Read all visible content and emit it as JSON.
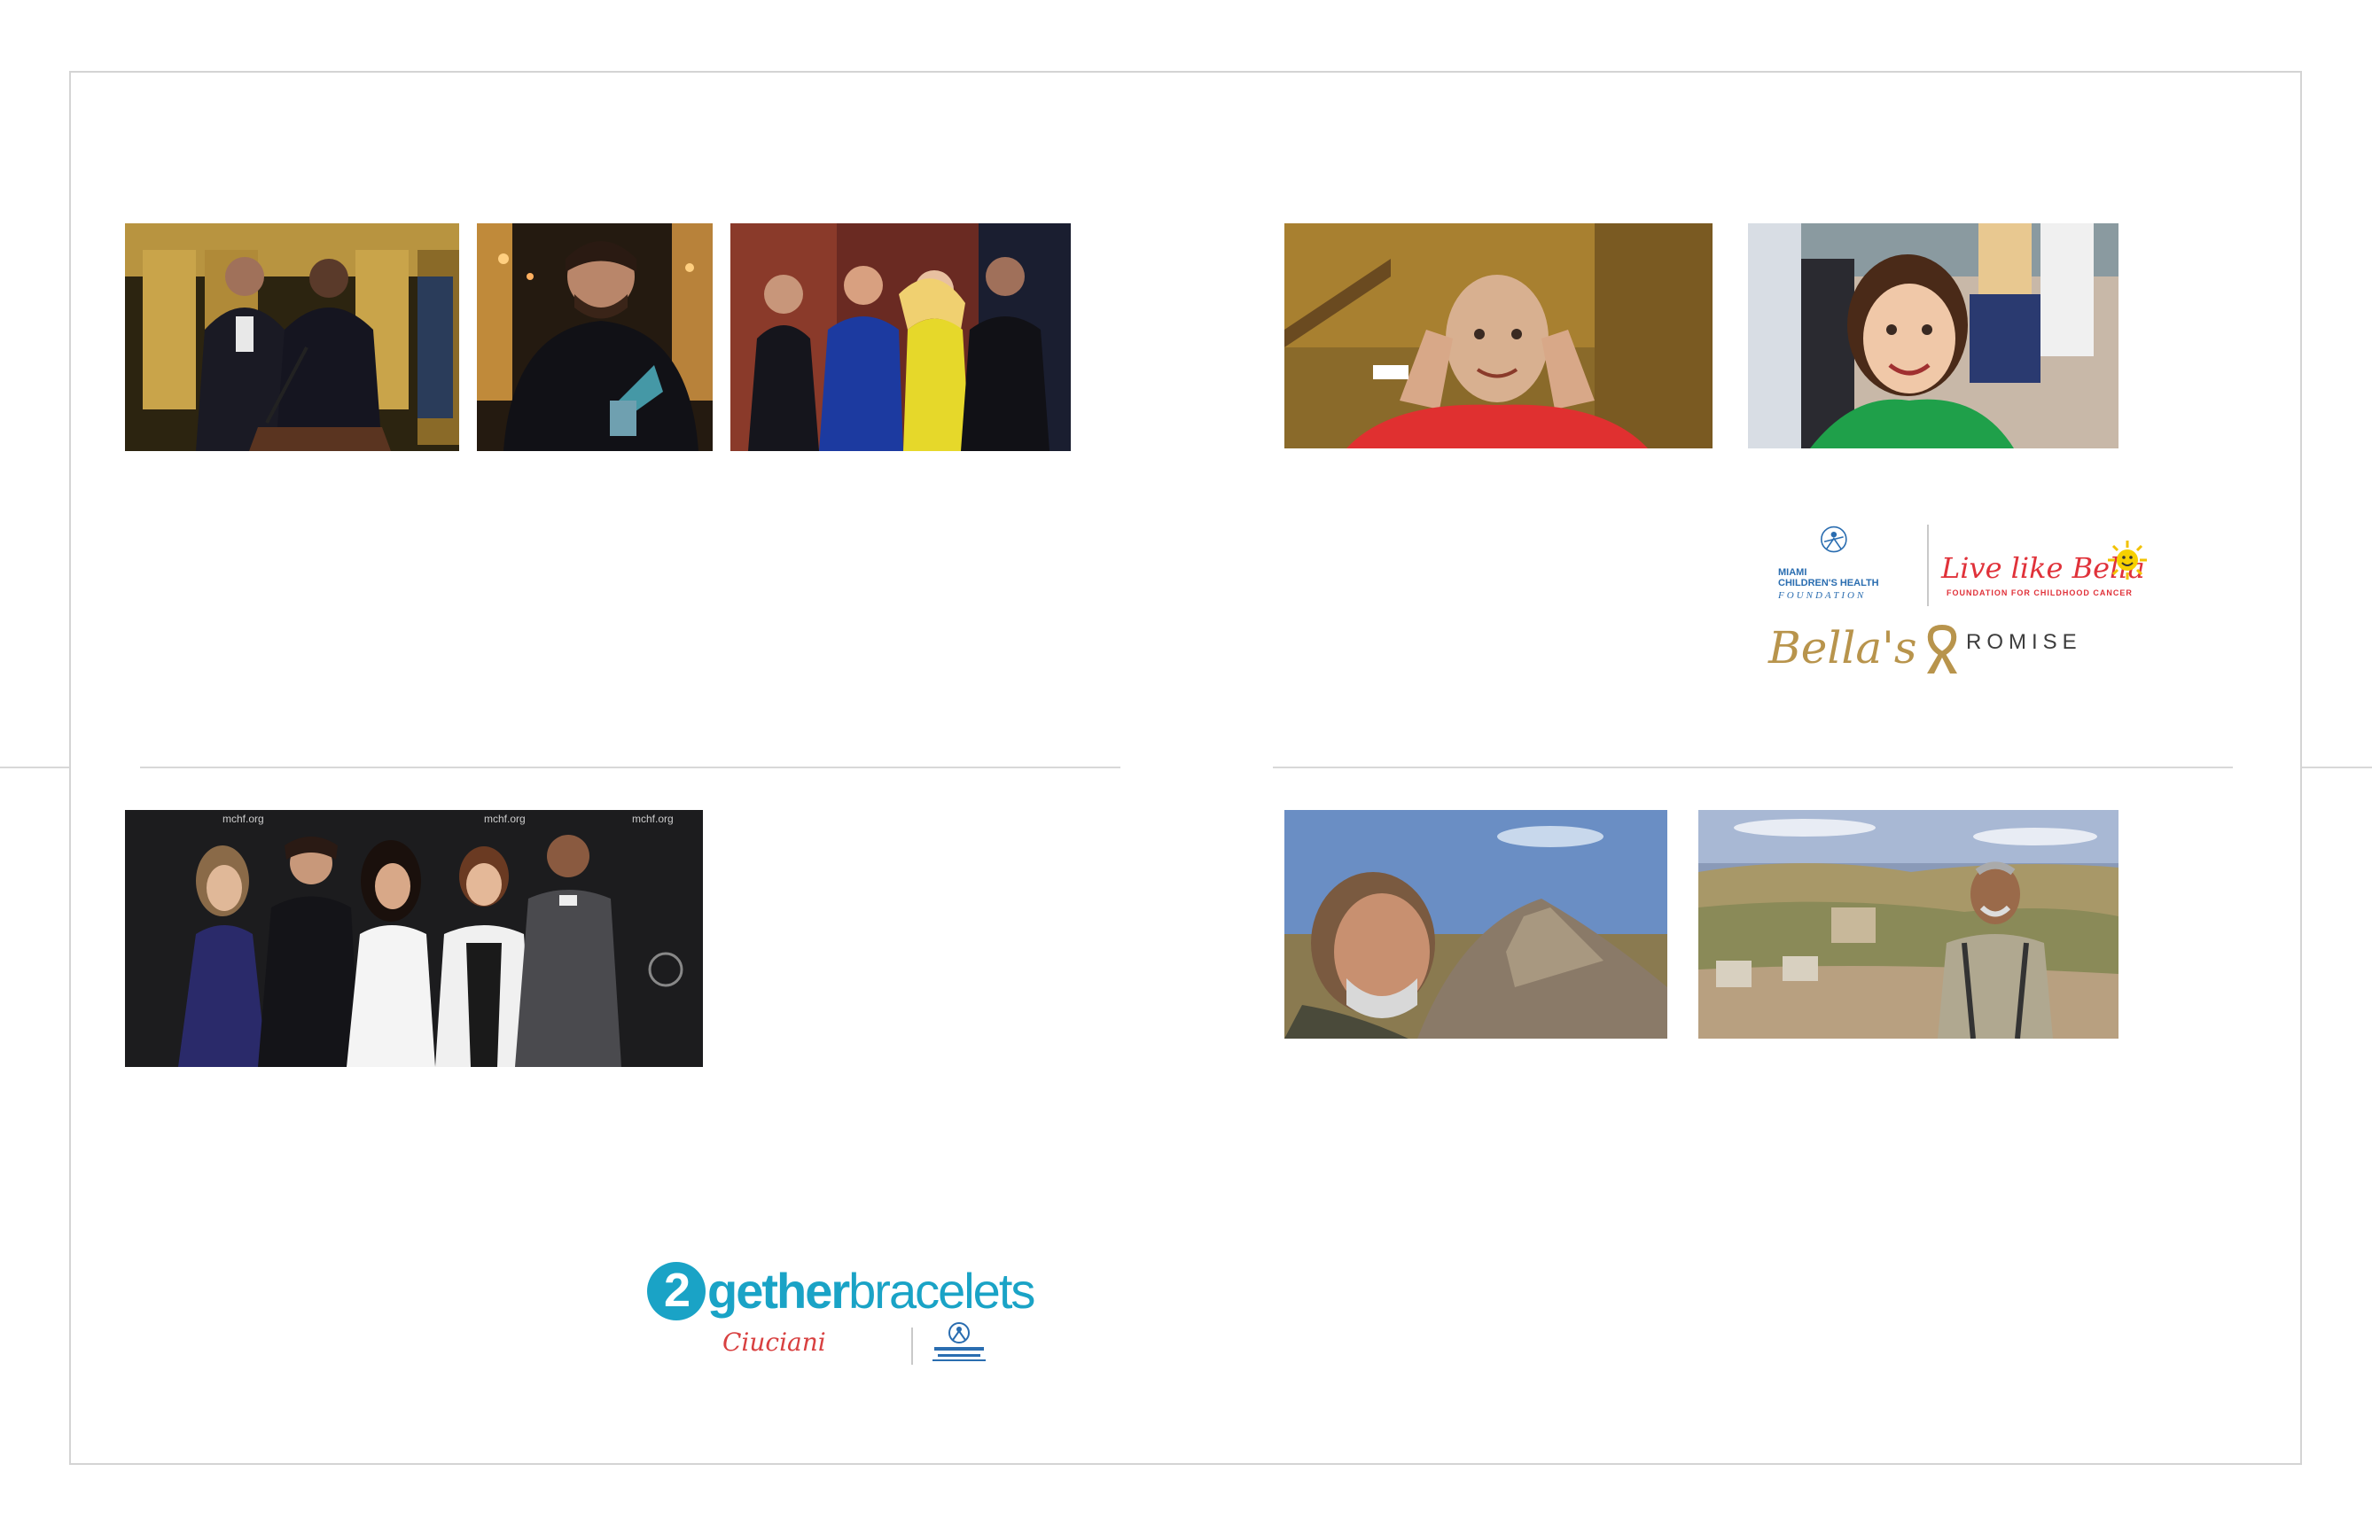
{
  "photos": [
    {
      "name": "photo-gala-podium",
      "description_icon": "photo-icon"
    },
    {
      "name": "photo-award-recipient",
      "description_icon": "photo-icon"
    },
    {
      "name": "photo-gala-group",
      "description_icon": "photo-icon"
    },
    {
      "name": "photo-bella-hospital",
      "description_icon": "photo-icon"
    },
    {
      "name": "photo-bella-smiling",
      "description_icon": "photo-icon"
    },
    {
      "name": "photo-bracelet-launch",
      "description_icon": "photo-icon"
    },
    {
      "name": "photo-hiker-cairn",
      "description_icon": "photo-icon"
    },
    {
      "name": "photo-hiker-valley",
      "description_icon": "photo-icon"
    }
  ],
  "logos": {
    "mchf": {
      "line1": "MIAMI",
      "line2": "CHILDREN'S HEALTH",
      "line3": "FOUNDATION"
    },
    "live_like_bella": {
      "title": "Live like Bella",
      "subtitle": "FOUNDATION FOR CHILDHOOD CANCER"
    },
    "bellas_promise": {
      "word1": "Bella's",
      "word2": "ROMISE"
    },
    "twogether": {
      "two": "2",
      "gether": "gether",
      "bracelets": "bracelets",
      "brand": "Ciuciani"
    },
    "backdrop_text": "mchf.org"
  },
  "colors": {
    "frame_border": "#d4d4d4",
    "mchf_blue": "#2a6db0",
    "bella_red": "#e0323a",
    "bella_gold": "#b8944c",
    "twogether_blue": "#1aa3c6"
  }
}
